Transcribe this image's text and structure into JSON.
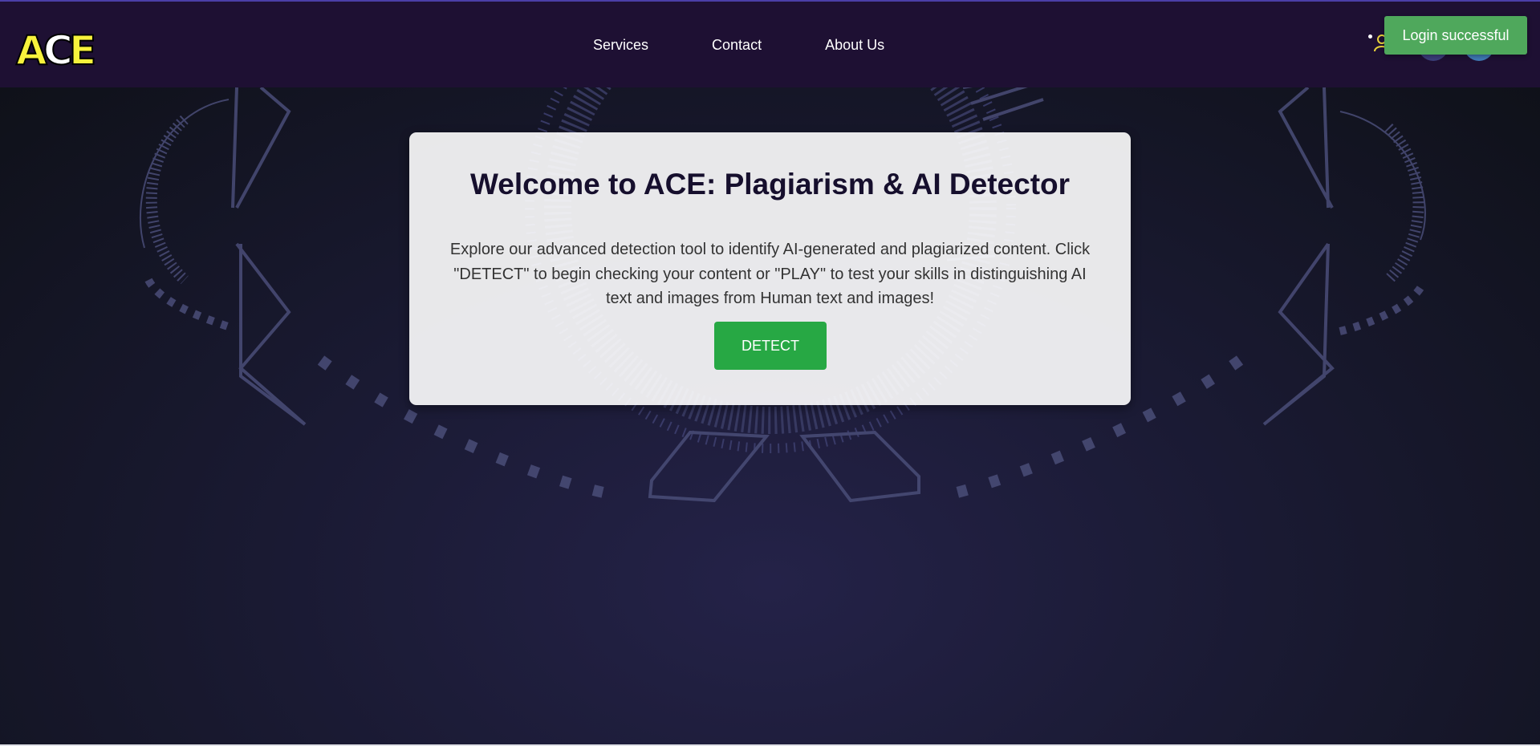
{
  "logo": {
    "text": "ACE",
    "colors": {
      "fill": "#f7f23c",
      "outline": "#000000",
      "second_letter": "#ffffff"
    }
  },
  "nav": {
    "links": [
      {
        "label": "Services"
      },
      {
        "label": "Contact"
      },
      {
        "label": "About Us"
      }
    ],
    "icons": [
      "user-icon",
      "facebook-icon",
      "twitter-icon"
    ]
  },
  "toast": {
    "message": "Login successful"
  },
  "welcome": {
    "title": "Welcome to ACE: Plagiarism & AI Detector",
    "description": "Explore our advanced detection tool to identify AI-generated and plagiarized content. Click \"DETECT\" to begin checking your content or \"PLAY\" to test your skills in distinguishing AI text and images from Human text and images!",
    "detect_label": "DETECT"
  },
  "colors": {
    "navbar": "#1e1033",
    "toast": "#4fa85c",
    "detect_button": "#27a844",
    "title_text": "#160f2d",
    "hero_bg": "#1a1a33"
  }
}
